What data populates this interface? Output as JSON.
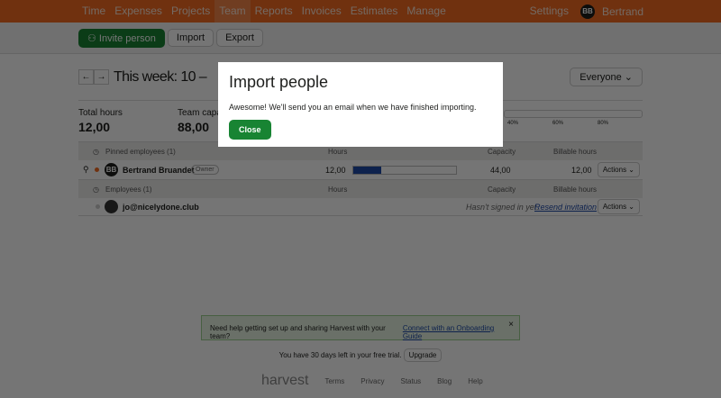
{
  "nav": {
    "items": [
      "Time",
      "Expenses",
      "Projects",
      "Team",
      "Reports",
      "Invoices",
      "Estimates",
      "Manage"
    ],
    "settings": "Settings",
    "user_initials": "BB",
    "user_name": "Bertrand"
  },
  "toolbar": {
    "invite": "Invite person",
    "import": "Import",
    "export": "Export"
  },
  "week": {
    "title": "This week: 10 –",
    "filter": "Everyone"
  },
  "stats": {
    "total_label": "Total hours",
    "total_value": "12,00",
    "capacity_label": "Team capaci",
    "capacity_value": "88,00",
    "ticks": [
      "40%",
      "60%",
      "80%"
    ]
  },
  "pinned": {
    "label": "Pinned employees (1)",
    "hours": "Hours",
    "capacity": "Capacity",
    "billable": "Billable hours"
  },
  "bertrand": {
    "initials": "BB",
    "name": "Bertrand Bruandet",
    "badge": "Owner",
    "hours": "12,00",
    "progress": 0.27,
    "capacity": "44,00",
    "billable": "12,00",
    "actions": "Actions"
  },
  "employees": {
    "label": "Employees (1)",
    "hours": "Hours",
    "capacity": "Capacity",
    "billable": "Billable hours"
  },
  "jo": {
    "email": "jo@nicelydone.club",
    "status": "Hasn't signed in yet.",
    "resend": "Resend invitation",
    "actions": "Actions"
  },
  "banner": {
    "text": "Need help getting set up and sharing Harvest with your team?",
    "link": "Connect with an Onboarding Guide"
  },
  "trial": {
    "text": "You have 30 days left in your free trial.",
    "upgrade": "Upgrade"
  },
  "footer": {
    "logo": "harvest",
    "links": [
      "Terms",
      "Privacy",
      "Status",
      "Blog",
      "Help"
    ]
  },
  "modal": {
    "title": "Import people",
    "message": "Awesome! We'll send you an email when we have finished importing.",
    "close": "Close"
  }
}
